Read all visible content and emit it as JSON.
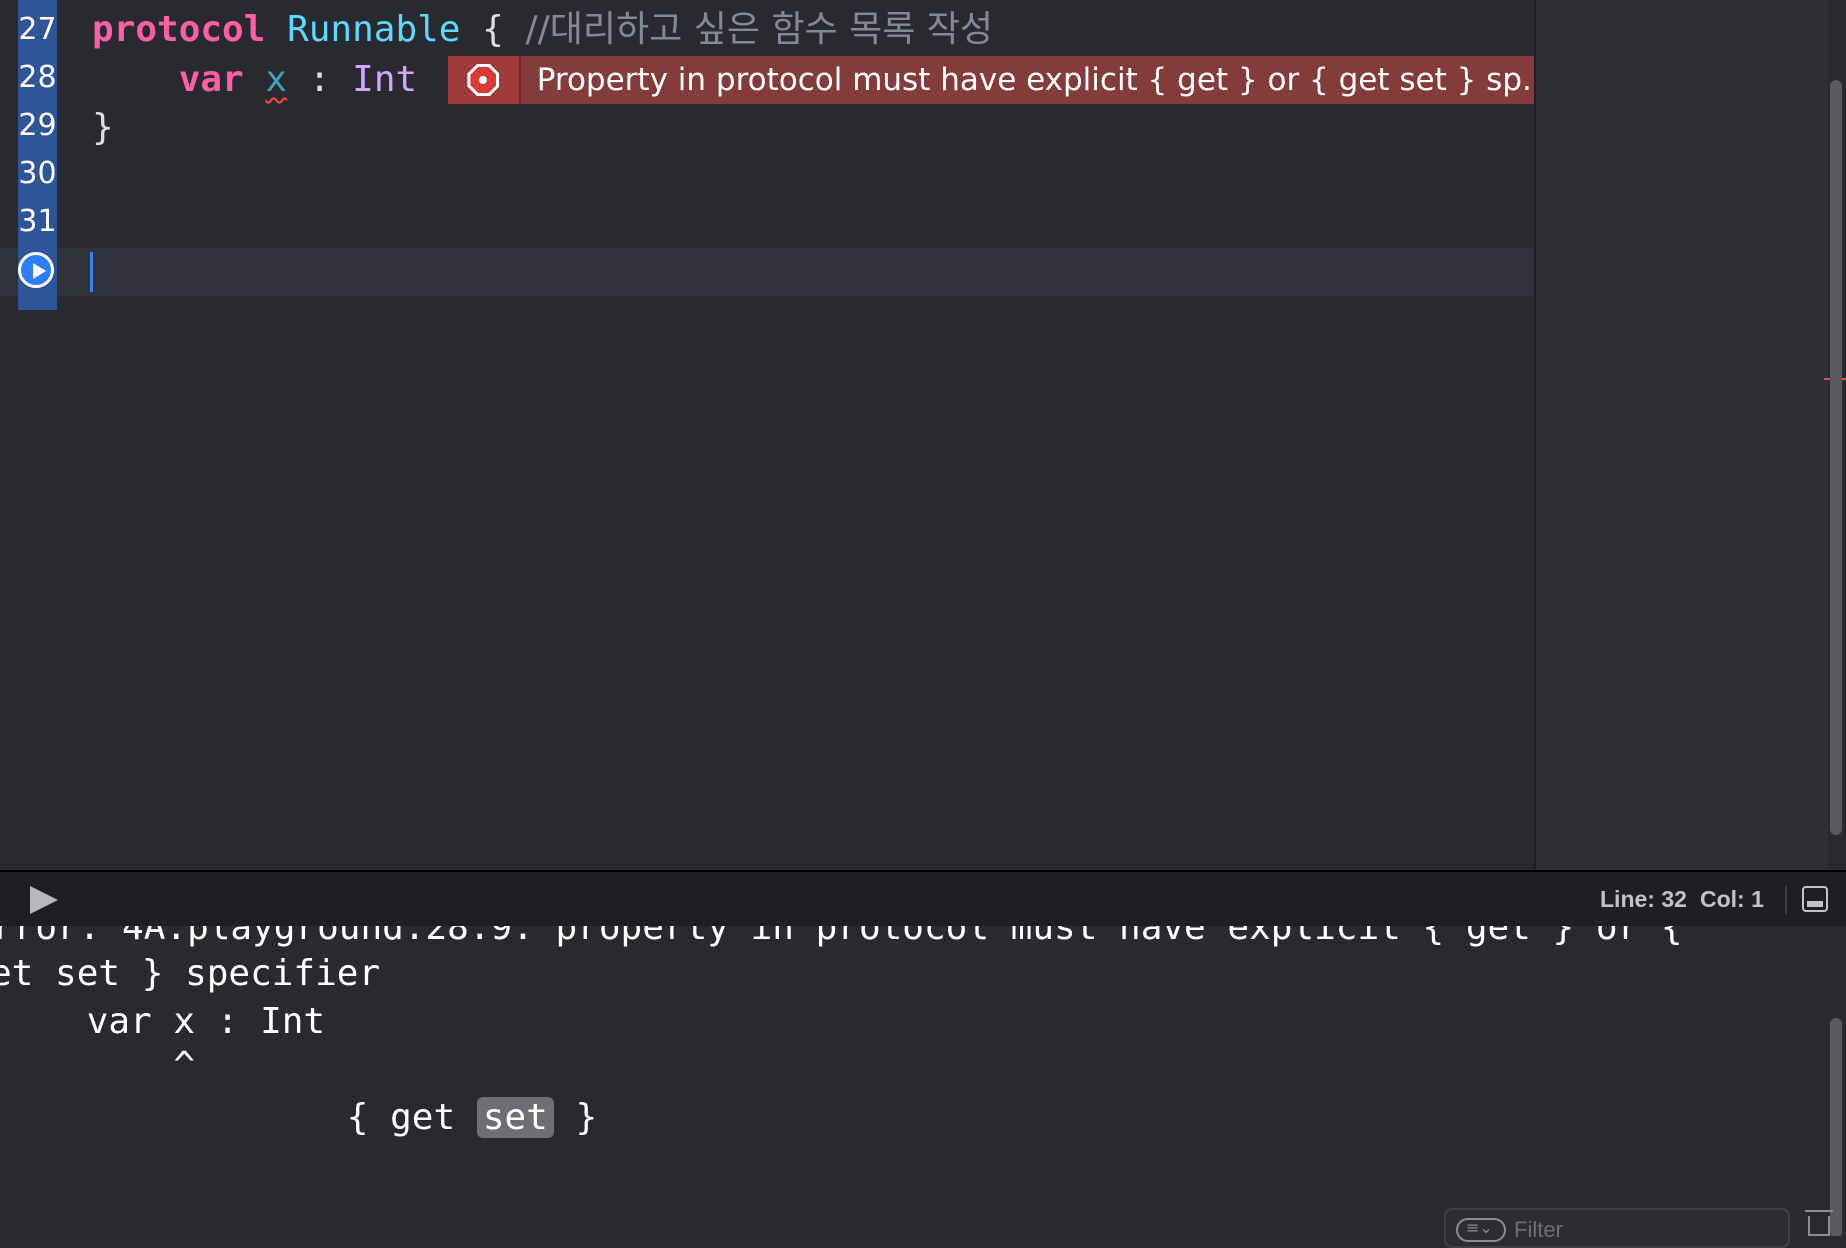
{
  "editor": {
    "line_numbers": [
      "27",
      "28",
      "29",
      "30",
      "31"
    ],
    "lines": {
      "l27": {
        "keyword": "protocol",
        "name": "Runnable",
        "brace": "{",
        "comment": "//대리하고 싶은 함수 목록 작성"
      },
      "l28": {
        "keyword": "var",
        "ident": "x",
        "colon": ":",
        "type": "Int"
      },
      "l29": {
        "brace": "}"
      }
    },
    "error_message": "Property in protocol must have explicit { get } or { get set } sp..."
  },
  "debug_bar": {
    "line_label": "Line: 32",
    "col_label": "Col: 1"
  },
  "console": {
    "lines": [
      "rror: 4A.playground:28:9: property in protocol must have explicit { get } or {",
      "et set } specifier",
      "    var x : Int",
      "        ^"
    ],
    "fixit_prefix": "{ get ",
    "fixit_highlight": "set",
    "fixit_suffix": " }",
    "filter_placeholder": "Filter"
  },
  "colors": {
    "background": "#292a30",
    "keyword": "#fc5fa3",
    "type": "#5dd8ff",
    "error_banner": "#843c3a",
    "gutter": "#2f5599"
  },
  "icons": [
    "run-icon",
    "error-icon",
    "play-icon",
    "toggle-console-icon",
    "filter-icon",
    "trash-icon"
  ]
}
